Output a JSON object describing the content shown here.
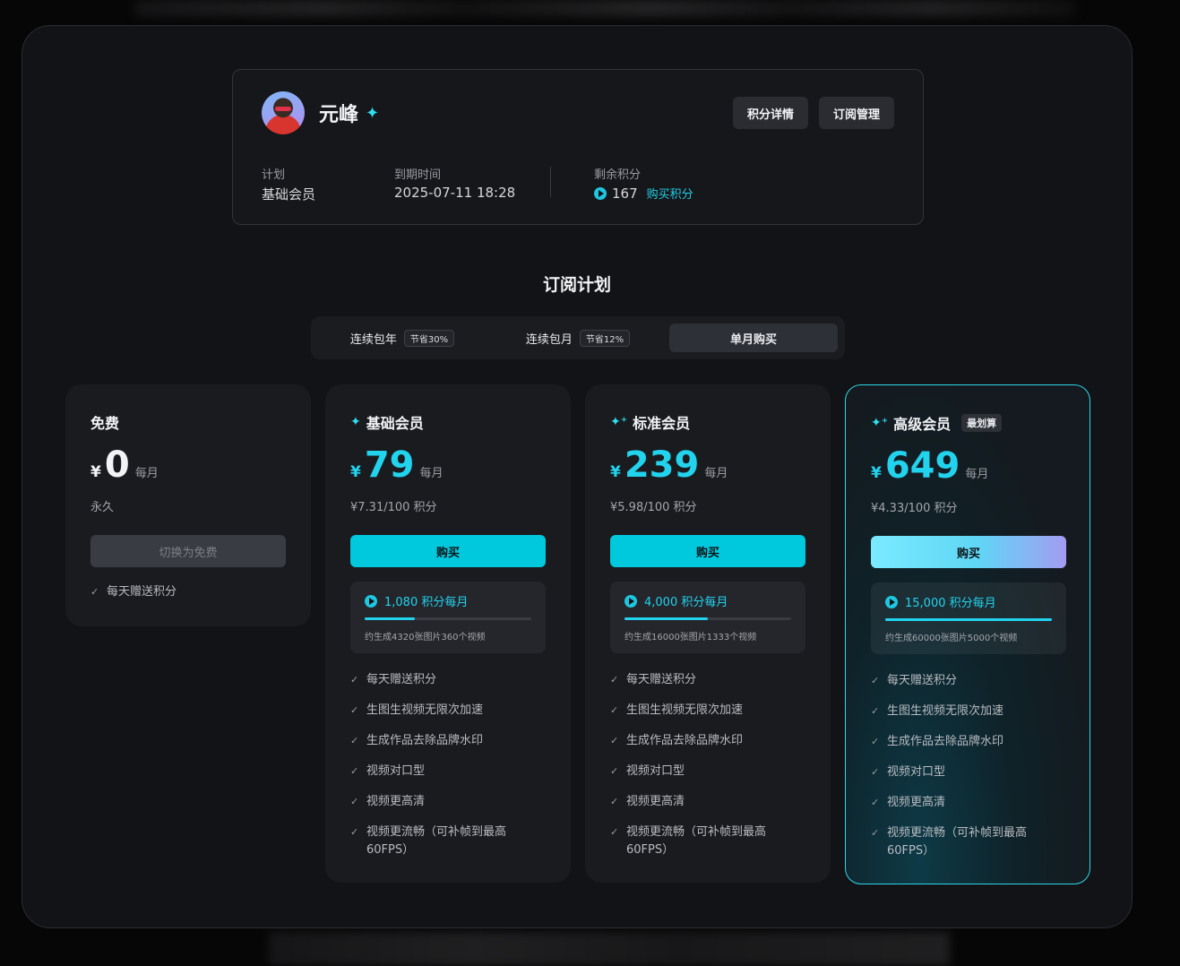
{
  "profile": {
    "username": "元峰",
    "points_details_label": "积分详情",
    "subscription_manage_label": "订阅管理",
    "plan_label": "计划",
    "plan_value": "基础会员",
    "expiry_label": "到期时间",
    "expiry_value": "2025-07-11 18:28",
    "remaining_label": "剩余积分",
    "remaining_value": "167",
    "buy_points_label": "购买积分"
  },
  "section_title": "订阅计划",
  "tabs": [
    {
      "label": "连续包年",
      "badge": "节省30%"
    },
    {
      "label": "连续包月",
      "badge": "节省12%"
    },
    {
      "label": "单月购买",
      "badge": ""
    }
  ],
  "plans": [
    {
      "name": "免费",
      "currency": "¥",
      "price": "0",
      "per": "每月",
      "sub": "永久",
      "button": "切换为免费",
      "features": [
        "每天赠送积分"
      ]
    },
    {
      "name": "基础会员",
      "currency": "¥",
      "price": "79",
      "per": "每月",
      "sub": "¥7.31/100 积分",
      "button": "购买",
      "credits_title": "1,080 积分每月",
      "credits_progress": 0.3,
      "credits_desc": "约生成4320张图片360个视频",
      "features": [
        "每天赠送积分",
        "生图生视频无限次加速",
        "生成作品去除品牌水印",
        "视频对口型",
        "视频更高清",
        "视频更流畅（可补帧到最高60FPS）"
      ]
    },
    {
      "name": "标准会员",
      "currency": "¥",
      "price": "239",
      "per": "每月",
      "sub": "¥5.98/100 积分",
      "button": "购买",
      "credits_title": "4,000 积分每月",
      "credits_progress": 0.5,
      "credits_desc": "约生成16000张图片1333个视频",
      "features": [
        "每天赠送积分",
        "生图生视频无限次加速",
        "生成作品去除品牌水印",
        "视频对口型",
        "视频更高清",
        "视频更流畅（可补帧到最高60FPS）"
      ]
    },
    {
      "name": "高级会员",
      "badge": "最划算",
      "currency": "¥",
      "price": "649",
      "per": "每月",
      "sub": "¥4.33/100 积分",
      "button": "购买",
      "credits_title": "15,000 积分每月",
      "credits_progress": 1.0,
      "credits_desc": "约生成60000张图片5000个视频",
      "features": [
        "每天赠送积分",
        "生图生视频无限次加速",
        "生成作品去除品牌水印",
        "视频对口型",
        "视频更高清",
        "视频更流畅（可补帧到最高60FPS）"
      ]
    }
  ],
  "colors": {
    "accent": "#22d3ee",
    "background": "#121316",
    "card": "#1a1b1f"
  }
}
